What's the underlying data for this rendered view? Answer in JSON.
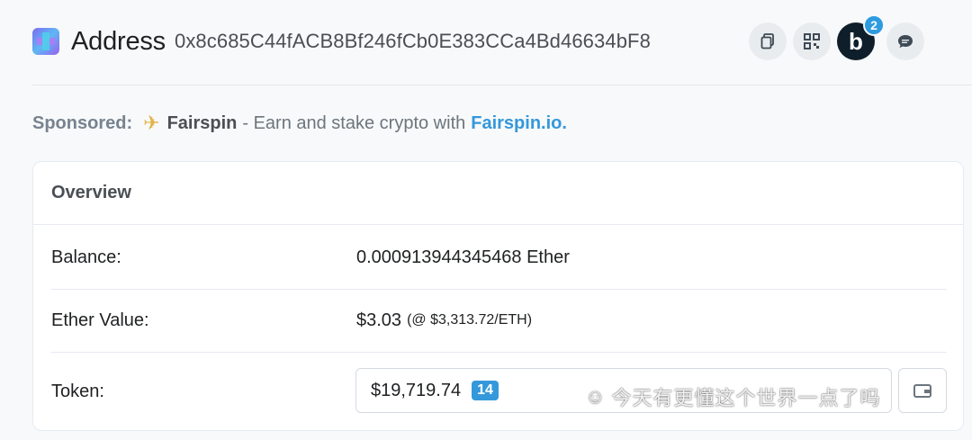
{
  "header": {
    "title": "Address",
    "address": "0x8c685C44fACB8Bf246fCb0E383CCa4Bd46634bF8",
    "icons": {
      "avatar": "identicon-avatar",
      "copy": "copy-icon",
      "qr": "qr-code-icon",
      "blockscan": "blockscan-chat-icon",
      "chat": "chat-bubble-icon"
    },
    "b_label": "b",
    "notification_count": "2"
  },
  "sponsored": {
    "label": "Sponsored:",
    "brand": "Fairspin",
    "text": "- Earn and stake crypto with",
    "link": "Fairspin.io."
  },
  "overview": {
    "title": "Overview",
    "balance_label": "Balance:",
    "balance_value": "0.000913944345468 Ether",
    "ether_value_label": "Ether Value:",
    "ether_value": "$3.03",
    "ether_price": "(@ $3,313.72/ETH)",
    "token_label": "Token:",
    "token_value": "$19,719.74",
    "token_count": "14"
  },
  "watermark": {
    "text": "今天有更懂这个世界一点了吗"
  },
  "colors": {
    "accent": "#3498db",
    "badge": "#2d9be0",
    "dark_button": "#0e1e2b"
  }
}
